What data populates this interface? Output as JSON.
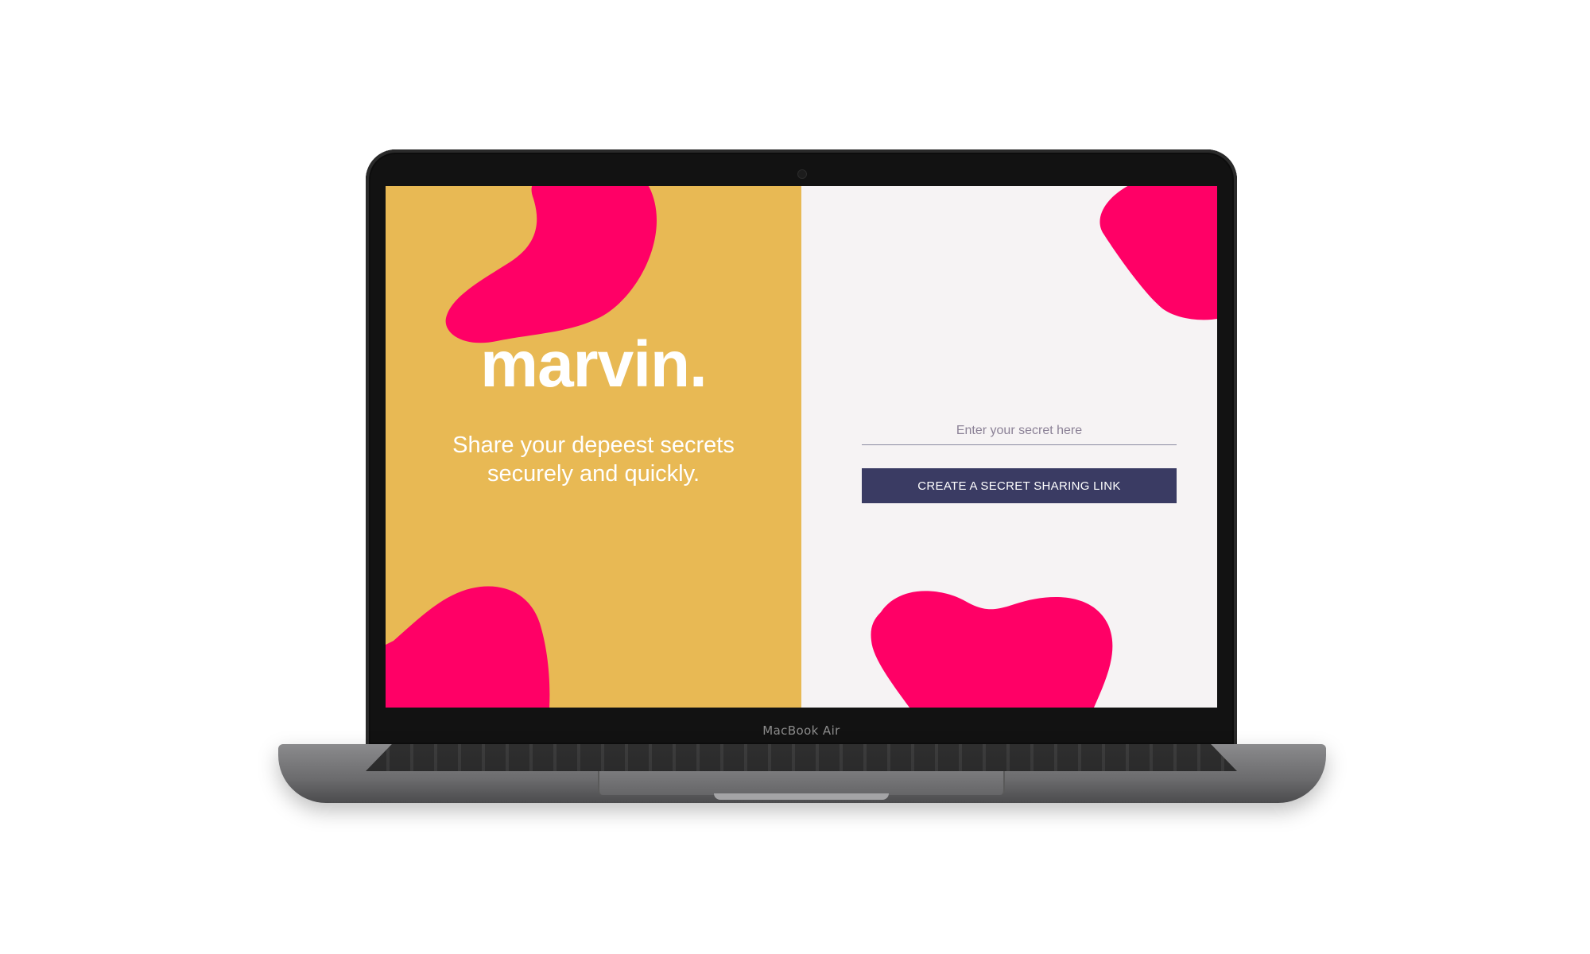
{
  "device": {
    "brand_label": "MacBook Air"
  },
  "app": {
    "logo_text": "marvin.",
    "tagline": "Share your depeest secrets securely and quickly.",
    "secret_field": {
      "placeholder": "Enter your secret here",
      "value": ""
    },
    "create_link_button": "CREATE A SECRET SHARING LINK"
  },
  "colors": {
    "left_panel_bg": "#e8b954",
    "right_panel_bg": "#f6f3f4",
    "blob": "#ff0066",
    "button_bg": "#3a3b63",
    "text_on_color": "#ffffff"
  },
  "icons": {
    "decorations": [
      "blob-shape"
    ]
  }
}
